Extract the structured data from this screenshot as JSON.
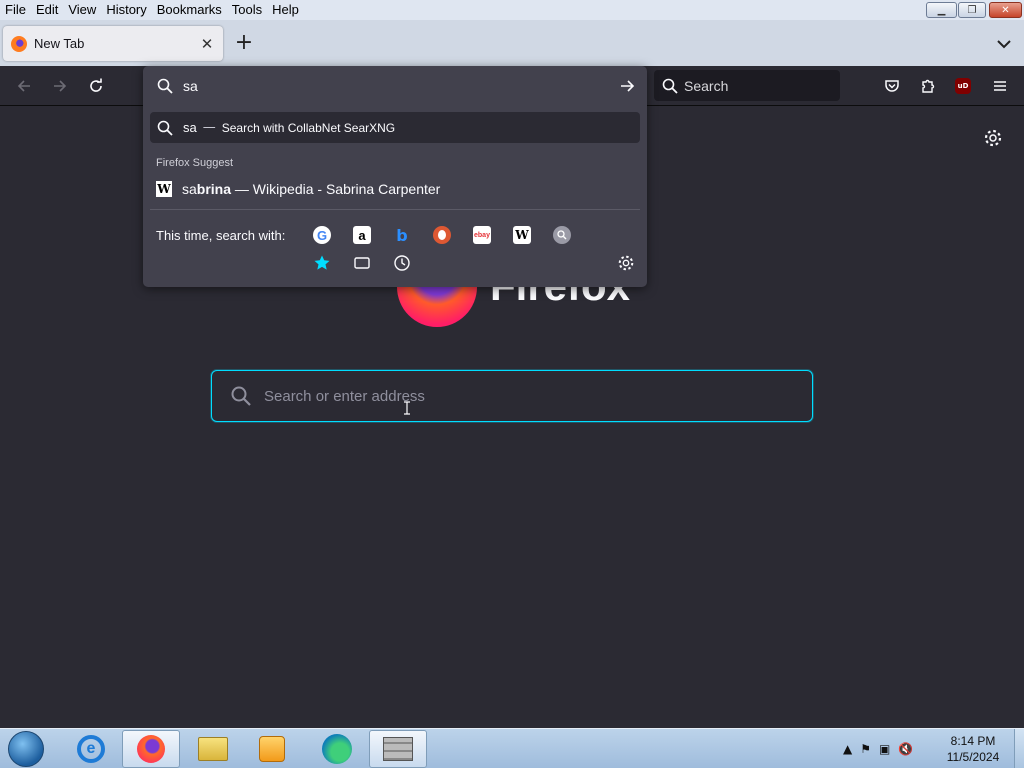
{
  "menu": [
    "File",
    "Edit",
    "View",
    "History",
    "Bookmarks",
    "Tools",
    "Help"
  ],
  "tab": {
    "title": "New Tab"
  },
  "toolbar": {
    "search_placeholder": "Search",
    "ublock_label": "uD"
  },
  "urlbar": {
    "value": "sa",
    "highlight_query": "sa",
    "highlight_sep": "—",
    "highlight_action": "Search with CollabNet SearXNG",
    "suggest_heading": "Firefox Suggest",
    "suggestion_match": "sa",
    "suggestion_rest": "brina",
    "suggestion_tail": " — Wikipedia - Sabrina Carpenter",
    "oneoff_label": "This time, search with:",
    "engines": [
      "Google",
      "Amazon",
      "Bing",
      "DuckDuckGo",
      "eBay",
      "Wikipedia",
      "SearXNG"
    ],
    "ebay_glyph": "ebay",
    "wiki_glyph": "W",
    "google_glyph": "G",
    "amazon_glyph": "a",
    "bing_glyph": "b"
  },
  "content": {
    "brand": "Firefox",
    "search_placeholder": "Search or enter address"
  },
  "taskbar": {
    "time": "8:14 PM",
    "date": "11/5/2024"
  },
  "colors": {
    "accent": "#00ddff",
    "background": "#2b2a33",
    "dropdown": "#42414d"
  }
}
